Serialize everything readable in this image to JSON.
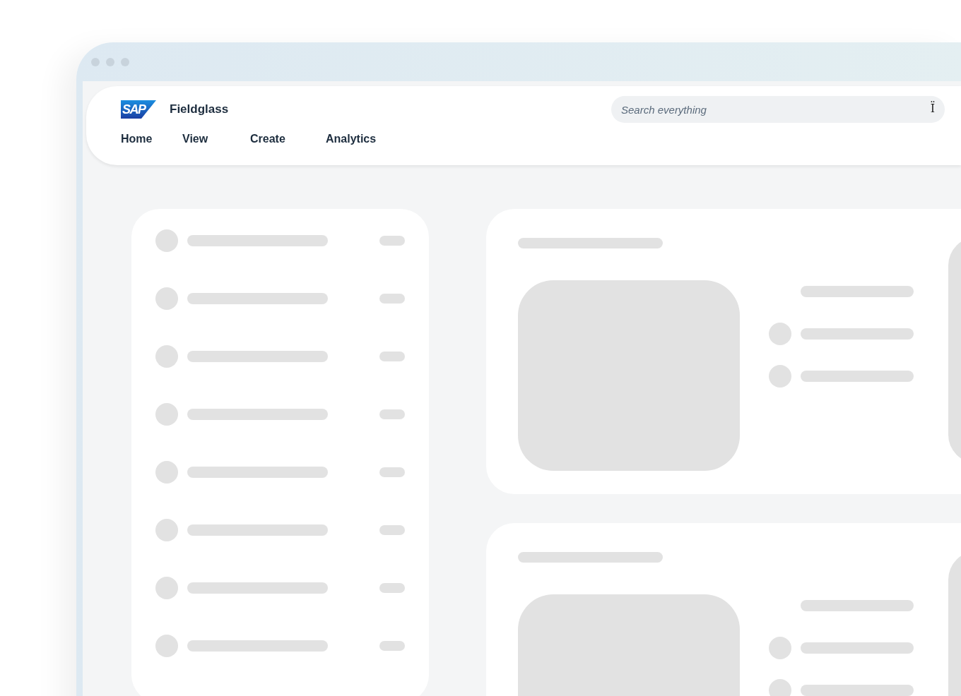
{
  "header": {
    "logo_text": "SAP",
    "product": "Fieldglass",
    "nav": [
      {
        "label": "Home"
      },
      {
        "label": "View"
      },
      {
        "label": "Create"
      },
      {
        "label": "Analytics"
      }
    ],
    "search": {
      "placeholder": "Search everything",
      "icon_glyph": "Ï"
    }
  }
}
